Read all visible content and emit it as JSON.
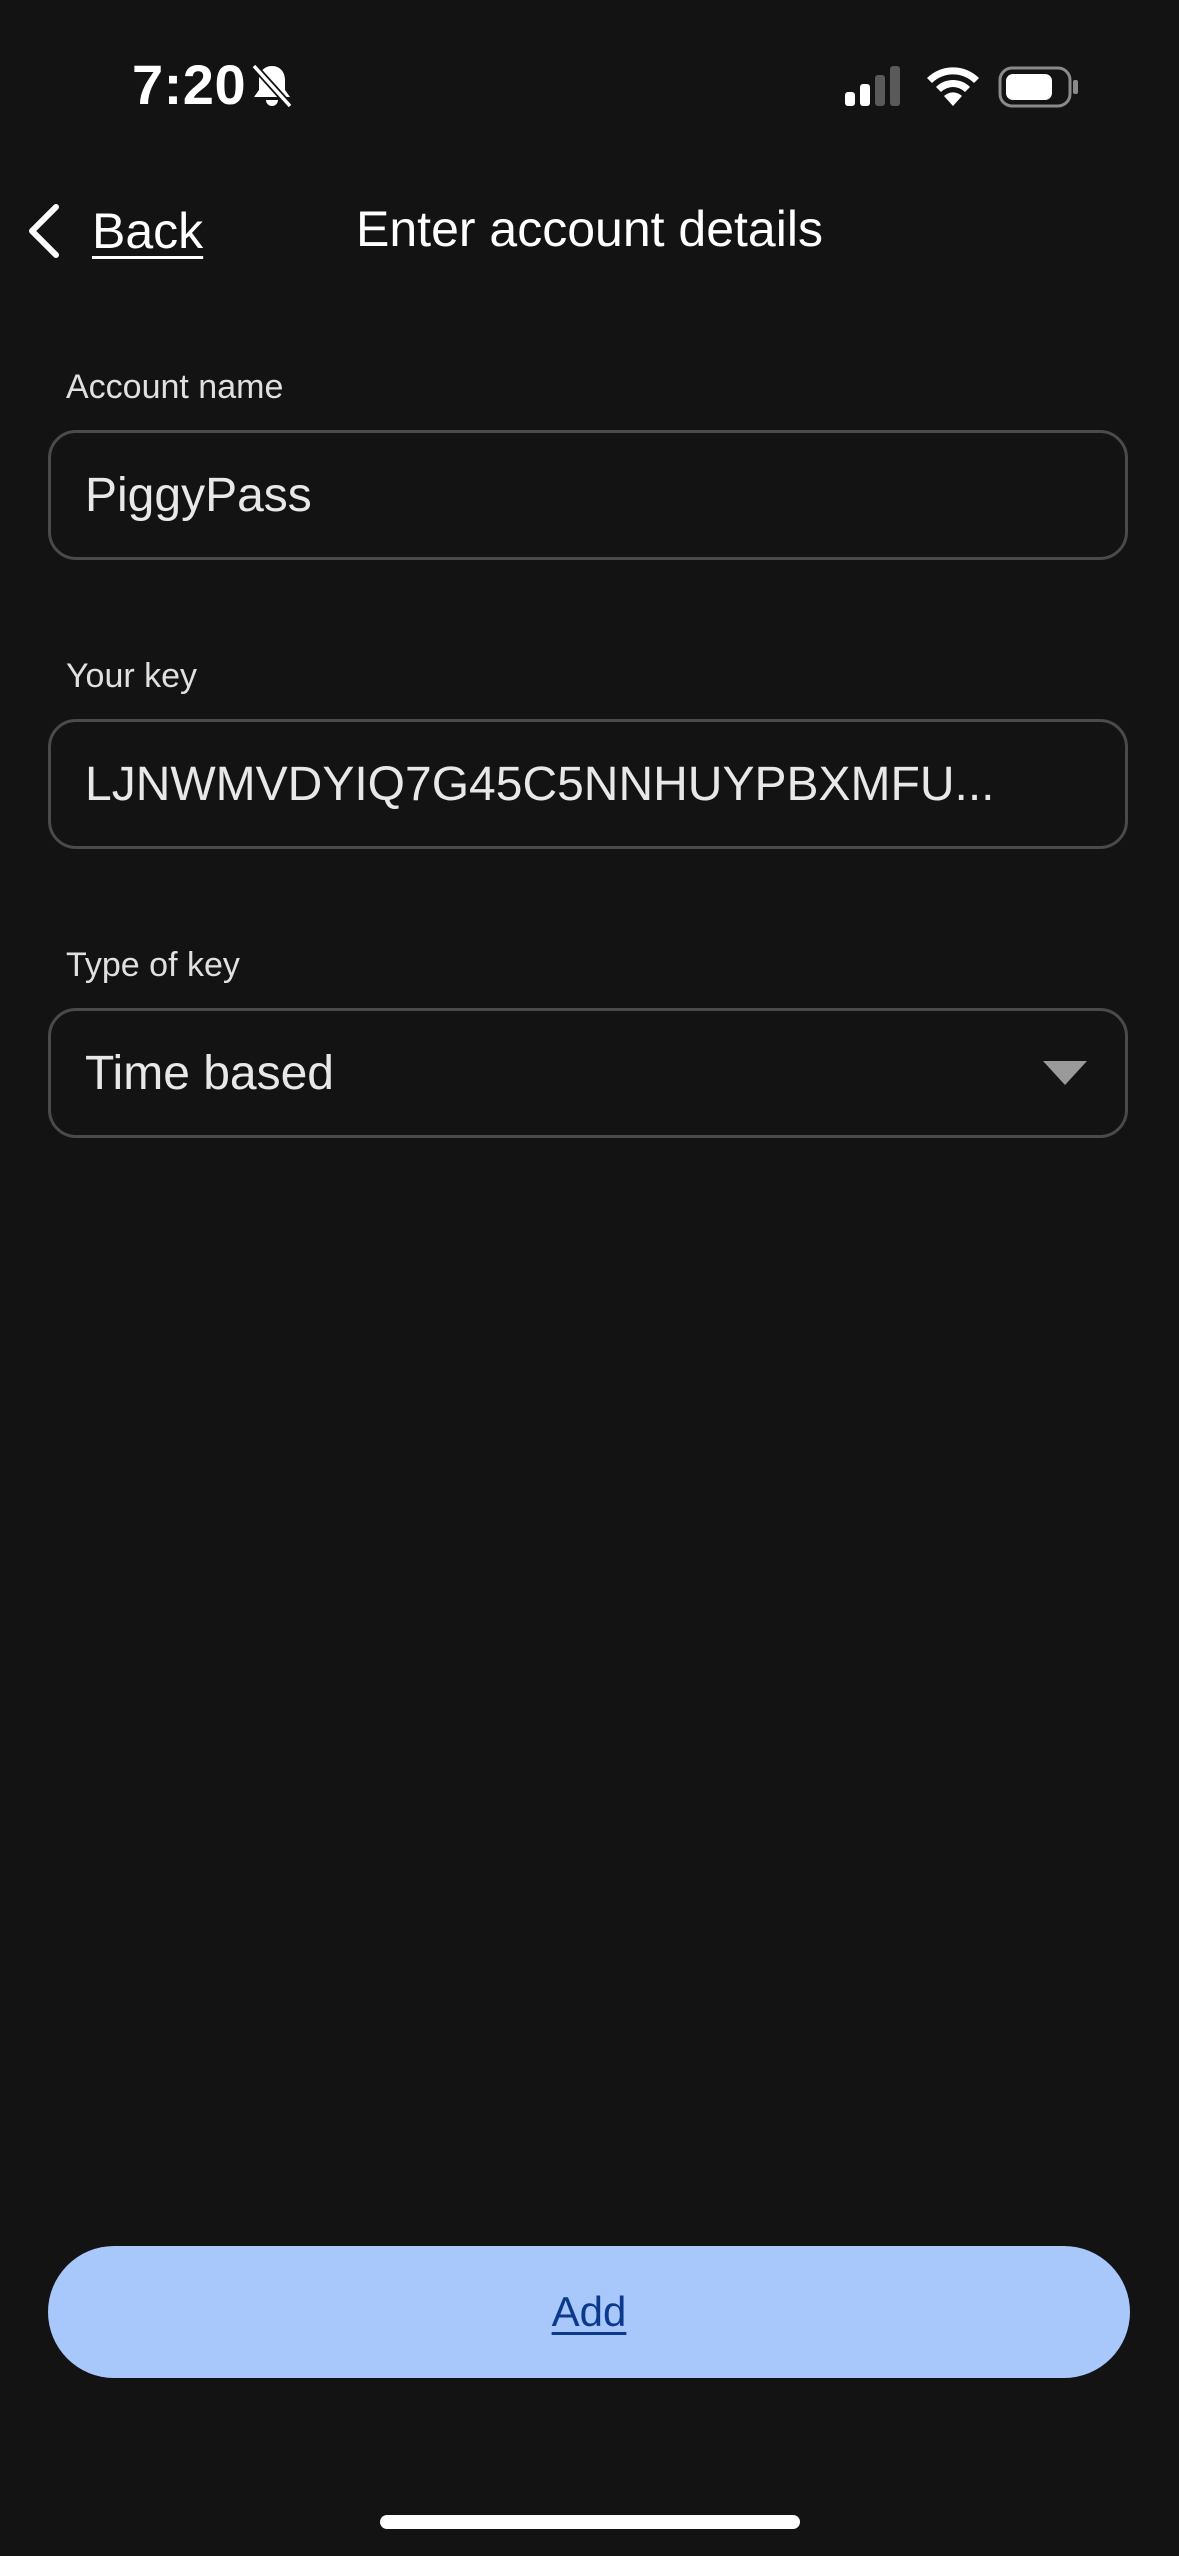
{
  "status_bar": {
    "time": "7:20",
    "icons": [
      "bell-slash-icon",
      "cellular-signal-icon",
      "wifi-icon",
      "battery-icon"
    ]
  },
  "header": {
    "back_label": "Back",
    "title": "Enter account details",
    "back_icon": "chevron-left-icon"
  },
  "form": {
    "account_name": {
      "label": "Account name",
      "value": "PiggyPass"
    },
    "key": {
      "label": "Your key",
      "value": "LJNWMVDYIQ7G45C5NNHUYPBXMFU..."
    },
    "key_type": {
      "label": "Type of key",
      "selected": "Time based",
      "icon": "dropdown-arrow-icon"
    }
  },
  "actions": {
    "add_label": "Add"
  },
  "colors": {
    "background": "#131313",
    "accent": "#a8c7fa",
    "accent_text": "#0b3a8c",
    "field_border": "#4a4a4a"
  }
}
